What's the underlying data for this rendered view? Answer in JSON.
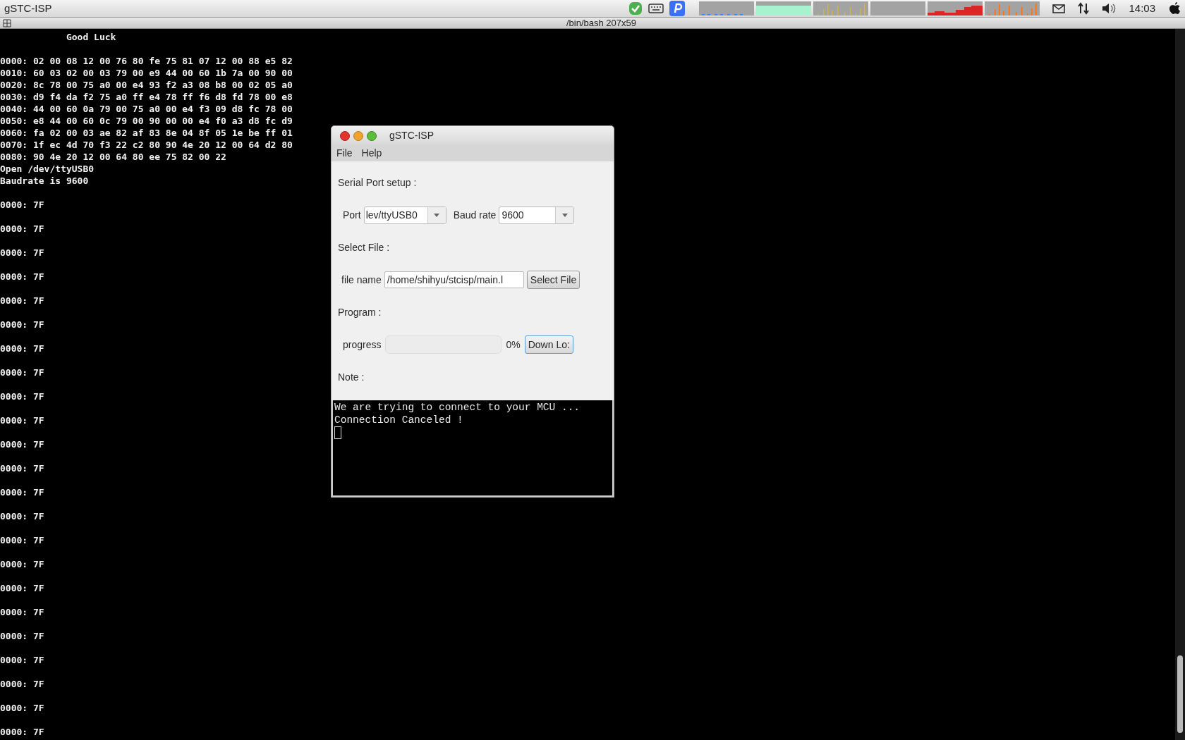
{
  "top_bar": {
    "app_name": "gSTC-ISP",
    "clock": "14:03"
  },
  "terminal": {
    "title": "/bin/bash 207x59",
    "blocks": [
      [
        "            Good Luck"
      ],
      [
        "0000: 02 00 08 12 00 76 80 fe 75 81 07 12 00 88 e5 82",
        "0010: 60 03 02 00 03 79 00 e9 44 00 60 1b 7a 00 90 00",
        "0020: 8c 78 00 75 a0 00 e4 93 f2 a3 08 b8 00 02 05 a0",
        "0030: d9 f4 da f2 75 a0 ff e4 78 ff f6 d8 fd 78 00 e8",
        "0040: 44 00 60 0a 79 00 75 a0 00 e4 f3 09 d8 fc 78 00",
        "0050: e8 44 00 60 0c 79 00 90 00 00 e4 f0 a3 d8 fc d9",
        "0060: fa 02 00 03 ae 82 af 83 8e 04 8f 05 1e be ff 01",
        "0070: 1f ec 4d 70 f3 22 c2 80 90 4e 20 12 00 64 d2 80",
        "0080: 90 4e 20 12 00 64 80 ee 75 82 00 22",
        "Open /dev/ttyUSB0",
        "Baudrate is 9600"
      ],
      [
        "0000: 7F"
      ],
      [
        "0000: 7F"
      ],
      [
        "0000: 7F"
      ],
      [
        "0000: 7F"
      ],
      [
        "0000: 7F"
      ],
      [
        "0000: 7F"
      ],
      [
        "0000: 7F"
      ],
      [
        "0000: 7F"
      ],
      [
        "0000: 7F"
      ],
      [
        "0000: 7F"
      ],
      [
        "0000: 7F"
      ],
      [
        "0000: 7F"
      ],
      [
        "0000: 7F"
      ],
      [
        "0000: 7F"
      ],
      [
        "0000: 7F"
      ],
      [
        "0000: 7F"
      ],
      [
        "0000: 7F"
      ],
      [
        "0000: 7F"
      ],
      [
        "0000: 7F"
      ],
      [
        "0000: 7F"
      ],
      [
        "0000: 7F"
      ],
      [
        "0000: 7F"
      ],
      [
        "0000: 7F"
      ]
    ]
  },
  "dialog": {
    "title": "gSTC-ISP",
    "menu": [
      "File",
      "Help"
    ],
    "serial_heading": "Serial Port setup :",
    "port_label": "Port",
    "port_value": "lev/ttyUSB0",
    "baud_label": "Baud rate",
    "baud_value": "9600",
    "file_heading": "Select File :",
    "file_label": "file name",
    "file_value": "/home/shihyu/stcisp/main.l",
    "select_button": "Select File",
    "program_heading": "Program :",
    "progress_label": "progress",
    "progress": {
      "level": 0
    },
    "percent": "0%",
    "download_button": "Down Lo:",
    "note_heading": "Note :",
    "log_lines": [
      "We are trying to connect to your MCU ...",
      "Connection Canceled !"
    ]
  }
}
